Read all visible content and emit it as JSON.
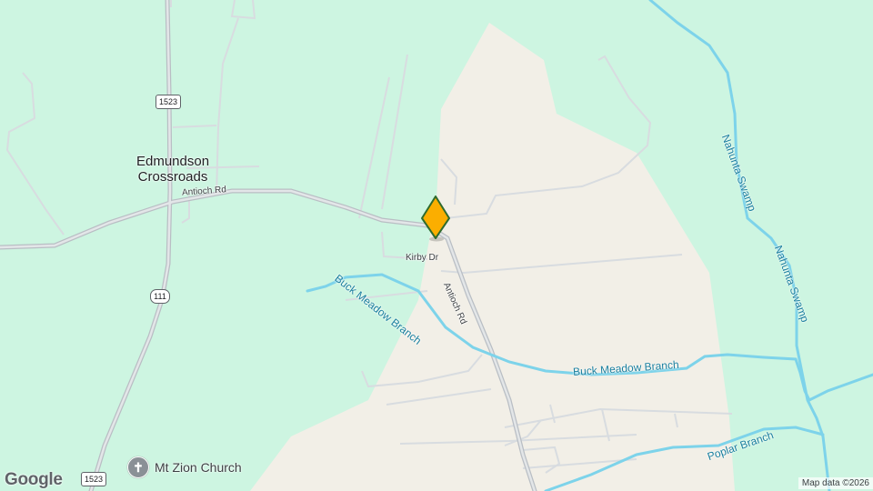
{
  "map": {
    "colors": {
      "land": "#cdf5e1",
      "farmland": "#f2efe7",
      "water": "#7dd3ea",
      "road_major": "#b9bec4",
      "road_minor": "#d8dce0",
      "marker_fill": "#fbae00",
      "marker_stroke": "#2f6b2e"
    },
    "places": {
      "town_line1": "Edmundson",
      "town_line2": "Crossroads"
    },
    "roads": {
      "antioch_west": "Antioch Rd",
      "antioch_south": "Antioch Rd",
      "kirby": "Kirby Dr"
    },
    "shields": {
      "route_1523_top": "1523",
      "route_111": "111",
      "route_1523_bottom": "1523"
    },
    "waterways": {
      "buck_meadow_upper": "Buck Meadow Branch",
      "buck_meadow_lower": "Buck Meadow Branch",
      "nahunta_upper": "Nahunta Swamp",
      "nahunta_lower": "Nahunta Swamp",
      "poplar": "Poplar Branch"
    },
    "poi": {
      "church_name": "Mt Zion Church",
      "church_icon": "cross-icon"
    },
    "marker_icon": "location-pin-icon",
    "logo": "Google",
    "attribution": "Map data ©2026"
  }
}
